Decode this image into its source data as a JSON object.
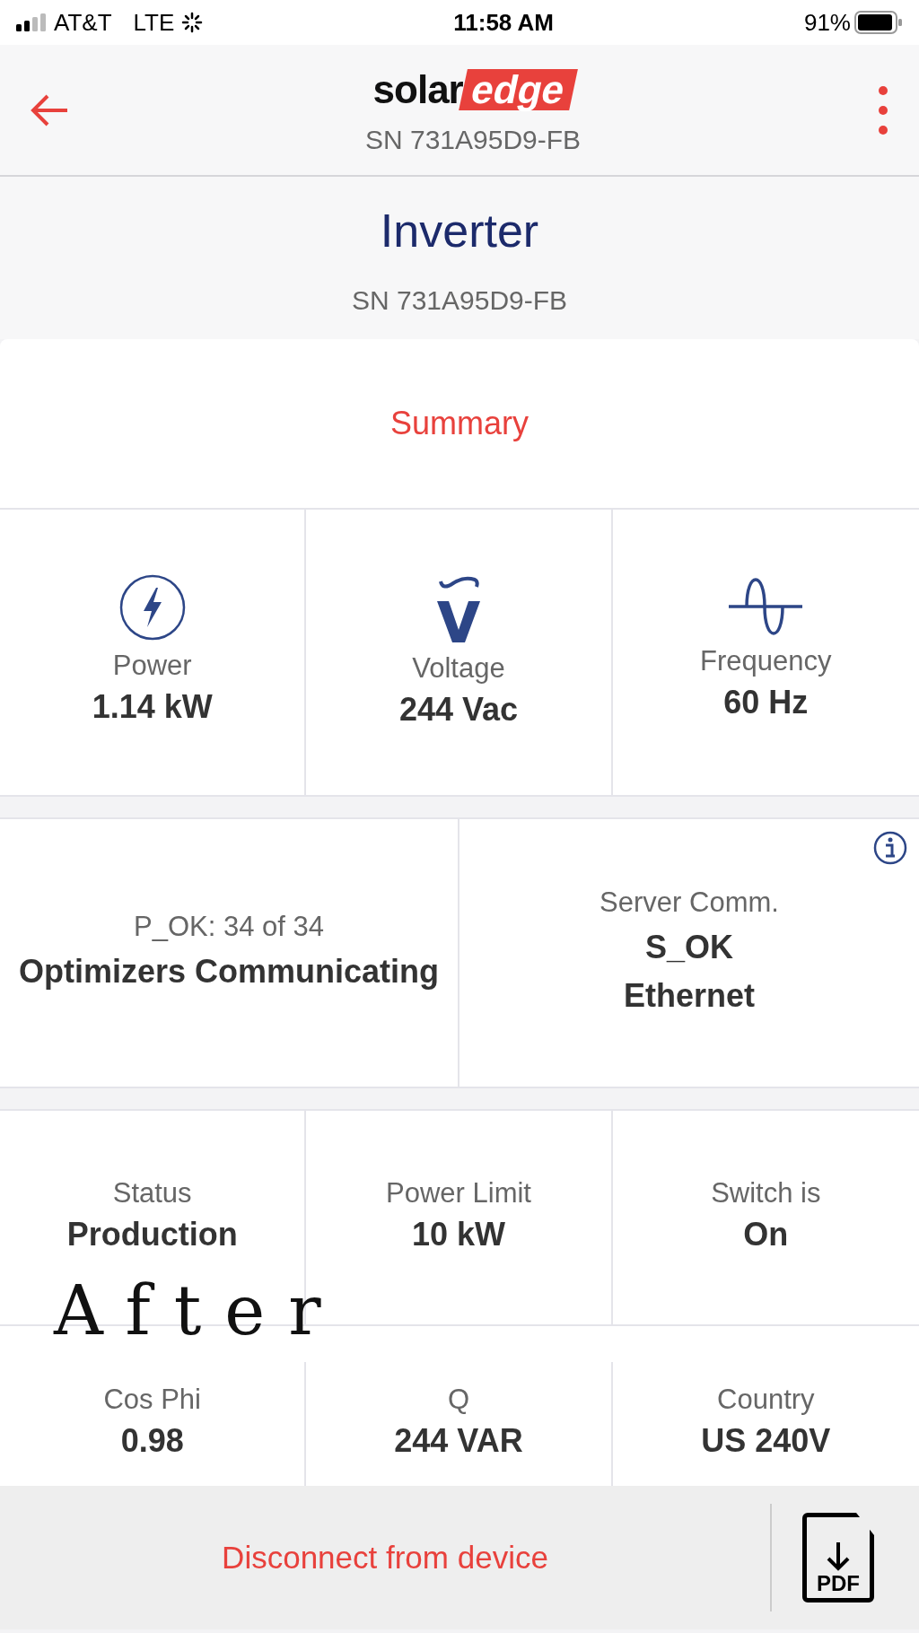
{
  "status_bar": {
    "carrier": "AT&T",
    "network": "LTE",
    "time": "11:58 AM",
    "battery": "91%"
  },
  "header": {
    "brand": [
      "solar",
      "edge"
    ],
    "serial": "SN 731A95D9-FB"
  },
  "title": "Inverter",
  "subtitle": "SN 731A95D9-FB",
  "section_tab": "Summary",
  "metrics": [
    {
      "kind": "power",
      "label": "Power",
      "value": "1.14 kW"
    },
    {
      "kind": "voltage",
      "label": "Voltage",
      "value": "244 Vac"
    },
    {
      "kind": "frequency",
      "label": "Frequency",
      "value": "60 Hz"
    }
  ],
  "communication": [
    {
      "label": "P_OK: 34 of 34",
      "values": [
        "Optimizers Communicating"
      ],
      "info": false
    },
    {
      "label": "Server Comm.",
      "values": [
        "S_OK",
        "Ethernet"
      ],
      "info": true
    }
  ],
  "details": [
    [
      {
        "label": "Status",
        "value": "Production"
      },
      {
        "label": "Power Limit",
        "value": "10 kW"
      },
      {
        "label": "Switch is",
        "value": "On"
      }
    ],
    [
      {
        "label": "Cos Phi",
        "value": "0.98"
      },
      {
        "label": "Q",
        "value": "244 VAR"
      },
      {
        "label": "Country",
        "value": "US 240V"
      }
    ]
  ],
  "annotation": "After",
  "footer": {
    "disconnect": "Disconnect from device",
    "pdf": "PDF"
  }
}
